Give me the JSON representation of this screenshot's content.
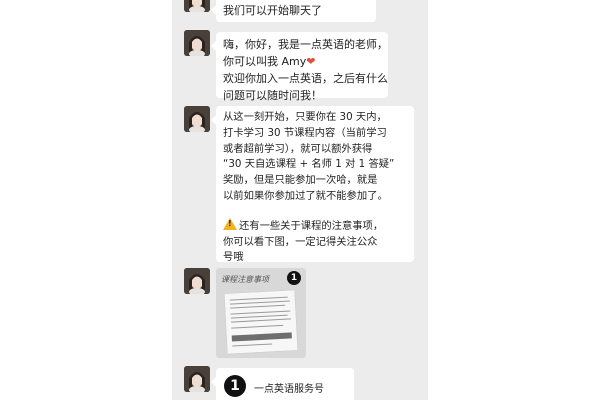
{
  "chat": {
    "messages": [
      {
        "type": "text",
        "lines": [
          "我们可以开始聊天了"
        ]
      },
      {
        "type": "text",
        "lines": [
          "嗨，你好，我是一点英语的老师，",
          "你可以叫我 Amy",
          "欢迎你加入一点英语，之后有什么",
          "问题可以随时问我！"
        ],
        "emoji": "heart-emoji"
      },
      {
        "type": "text",
        "lines": [
          "从这一刻开始，只要你在 30 天内，",
          "打卡学习 30 节课程内容（当前学习",
          "或者超前学习），就可以额外获得",
          "“30 天自选课程 + 名师 1 对 1 答疑”",
          "奖励，但是只能参加一次哈，就是",
          "以前如果你参加过了就不能参加了。",
          "",
          "还有一些关于课程的注意事项，",
          "你可以看下图，一定记得关注公众",
          "号哦"
        ],
        "emoji": "warning-emoji"
      },
      {
        "type": "image",
        "title": "课程注意事项",
        "logo": "1"
      },
      {
        "type": "card",
        "logo": "1",
        "name": "一点英语服务号"
      }
    ]
  },
  "colors": {
    "chat_background": "#ececec",
    "bubble": "#ffffff",
    "heart": "#e0503a",
    "warning": "#f2b31c"
  }
}
